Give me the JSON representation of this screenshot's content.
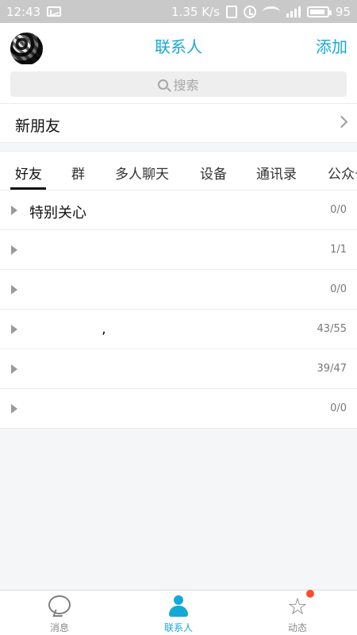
{
  "status": {
    "time": "12:43",
    "speed": "1.35 K/s",
    "battery": "95"
  },
  "header": {
    "title": "联系人",
    "add_label": "添加"
  },
  "search": {
    "placeholder": "搜索"
  },
  "new_friends": {
    "label": "新朋友"
  },
  "tabs": [
    {
      "label": "好友"
    },
    {
      "label": "群"
    },
    {
      "label": "多人聊天"
    },
    {
      "label": "设备"
    },
    {
      "label": "通讯录"
    },
    {
      "label": "公众号"
    }
  ],
  "groups": [
    {
      "name": "特别关心",
      "count": "0/0"
    },
    {
      "name": "",
      "count": "1/1"
    },
    {
      "name": "",
      "count": "0/0"
    },
    {
      "name": ",",
      "count": "43/55"
    },
    {
      "name": "",
      "count": "39/47"
    },
    {
      "name": "",
      "count": "0/0"
    }
  ],
  "bottom_nav": [
    {
      "label": "消息",
      "icon": "message-icon"
    },
    {
      "label": "联系人",
      "icon": "contacts-icon"
    },
    {
      "label": "动态",
      "icon": "star-icon"
    }
  ],
  "colors": {
    "accent": "#14a9d8",
    "status_bar": "#c9c9c9",
    "badge": "#ff4b2b"
  }
}
